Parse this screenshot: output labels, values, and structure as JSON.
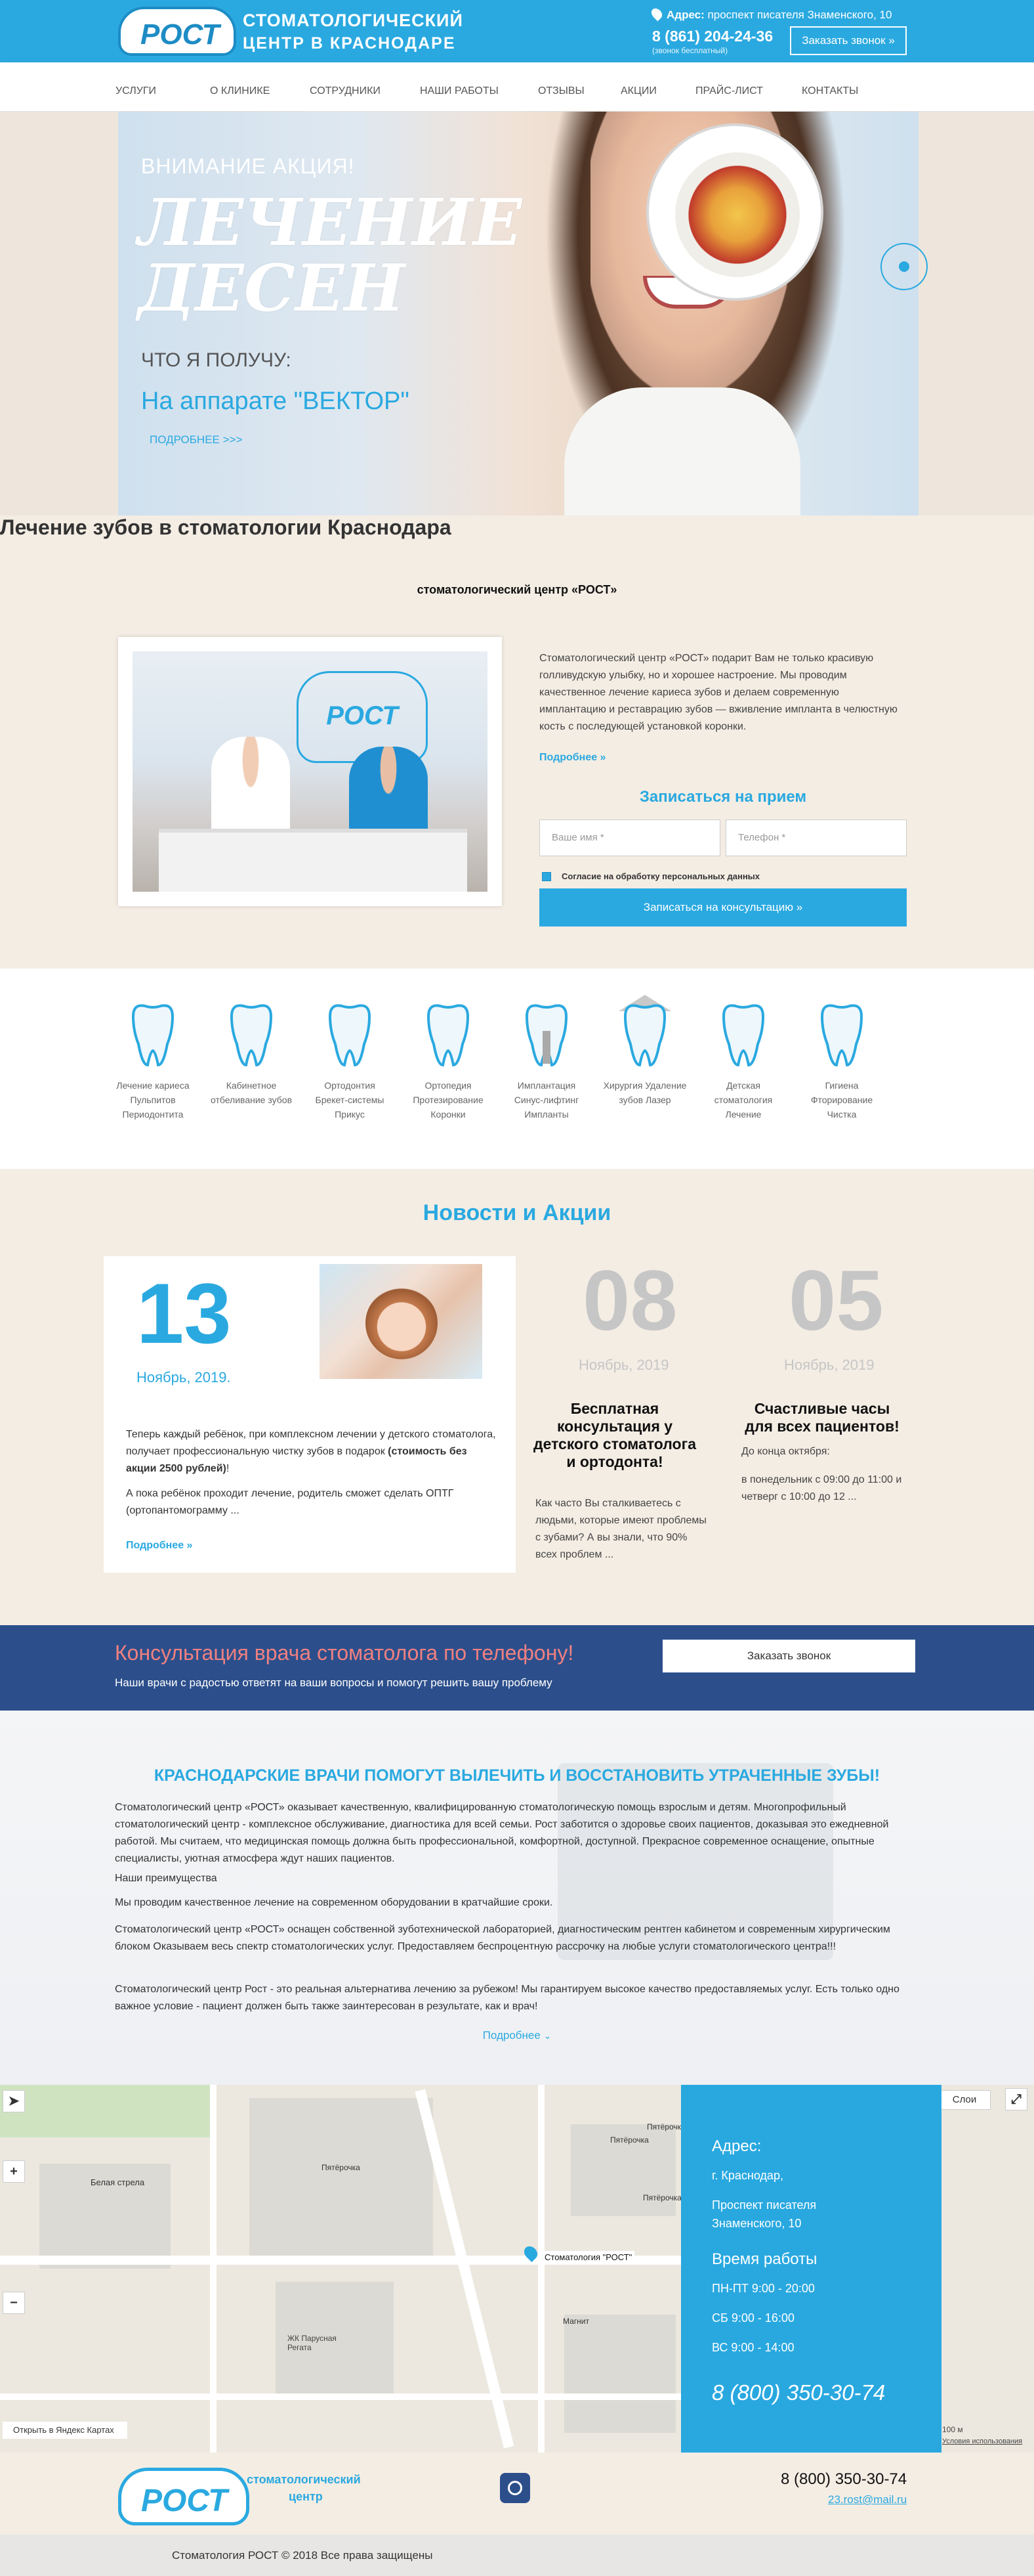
{
  "header": {
    "logo_word": "РОСТ",
    "logo_line1": "СТОМАТОЛОГИЧЕСКИЙ",
    "logo_line2": "ЦЕНТР В КРАСНОДАРЕ",
    "address_label": "Адрес:",
    "address": "проспект писателя Знаменского, 10",
    "phone": "8 (861) 204-24-36",
    "phone_note": "(звонок бесплатный)",
    "callback": "Заказать звонок"
  },
  "nav": [
    "Услуги",
    "О клинике",
    "Сотрудники",
    "Наши работы",
    "Отзывы",
    "Акции",
    "Прайс-лист",
    "Контакты"
  ],
  "hero": {
    "kicker": "ВНИМАНИЕ АКЦИЯ!",
    "title_l1": "ЛЕЧЕНИЕ",
    "title_l2": "ДЕСЕН",
    "question": "ЧТО Я ПОЛУЧУ:",
    "device": "На аппарате \"ВЕКТОР\"",
    "more": "ПОДРОБНЕЕ >>>"
  },
  "about": {
    "title": "Лечение зубов в стоматологии Краснодара",
    "subtitle": "стоматологический центр «РОСТ»",
    "wall_logo": "РОСТ",
    "text": "Стоматологический центр «РОСТ» подарит Вам не только красивую голливудскую улыбку, но и хорошее настроение. Мы проводим качественное лечение кариеса зубов и делаем современную имплантацию и реставрацию зубов — вживление импланта в челюстную кость с последующей установкой коронки.",
    "more": "Подробнее »",
    "form_title": "Записаться на прием",
    "name_placeholder": "Ваше имя *",
    "phone_placeholder": "Телефон *",
    "consent": "Согласие на обработку персональных данных",
    "submit": "Записаться на консультацию »"
  },
  "services": [
    {
      "l1": "Лечение кариеса",
      "l2": "Пульпитов",
      "l3": "Периодонтита"
    },
    {
      "l1": "Кабинетное",
      "l2": "отбеливание зубов",
      "l3": ""
    },
    {
      "l1": "Ортодонтия",
      "l2": "Брекет-системы",
      "l3": "Прикус"
    },
    {
      "l1": "Ортопедия",
      "l2": "Протезирование",
      "l3": "Коронки"
    },
    {
      "l1": "Имплантация",
      "l2": "Синус-лифтинг",
      "l3": "Импланты"
    },
    {
      "l1": "Хирургия Удаление",
      "l2": "зубов Лазер",
      "l3": ""
    },
    {
      "l1": "Детская",
      "l2": "стоматология",
      "l3": "Лечение"
    },
    {
      "l1": "Гигиена",
      "l2": "Фторирование",
      "l3": "Чистка"
    }
  ],
  "news": {
    "title": "Новости и Акции",
    "main": {
      "day": "13",
      "month": "Ноябрь, 2019.",
      "p1_a": "Теперь каждый ребёнок, при комплексном лечении у детского стоматолога, получает профессиональную чистку зубов в подарок ",
      "p1_b": "(стоимость без акции 2500 рублей)",
      "p1_c": "!",
      "p2": "А пока ребёнок проходит лечение, родитель сможет сделать ОПТГ (ортопантомограмму ...",
      "more": "Подробнее »"
    },
    "items": [
      {
        "day": "08",
        "month": "Ноябрь, 2019",
        "title": "Бесплатная консультация у детского стоматолога и ортодонта!",
        "text": "Как часто  Вы сталкиваетесь с людьми, которые имеют проблемы с зубами? А вы знали, что 90% всех проблем ..."
      },
      {
        "day": "05",
        "month": "Ноябрь, 2019",
        "title": "Счастливые часы для всех пациентов!",
        "text1": "До конца октября:",
        "text2": "в понедельник с 09:00 до 11:00 и четверг с 10:00 до 12 ..."
      }
    ]
  },
  "band": {
    "title": "Консультация врача стоматолога по телефону!",
    "subtitle": "Наши врачи с радостью ответят на ваши вопросы и помогут решить вашу проблему",
    "button": "Заказать звонок"
  },
  "info": {
    "title": "КРАСНОДАРСКИЕ ВРАЧИ ПОМОГУТ ВЫЛЕЧИТЬ И ВОССТАНОВИТЬ УТРАЧЕННЫЕ ЗУБЫ!",
    "p1": "Стоматологический центр «РОСТ» оказывает качественную, квалифицированную стоматологическую помощь взрослым и детям. Многопрофильный стоматологический центр - комплексное обслуживание, диагностика для всей семьи. Рост заботится о здоровье своих пациентов, доказывая это ежедневной работой. Мы считаем, что медицинская помощь должна быть профессиональной, комфортной, доступной. Прекрасное современное оснащение, опытные специалисты, уютная атмосфера ждут наших пациентов.",
    "p2": "Наши преимущества",
    "p3": "Мы проводим качественное лечение на современном оборудовании в кратчайшие сроки.",
    "p4": "Стоматологический центр «РОСТ» оснащен собственной зуботехнической лабораторией, диагностическим рентген кабинетом и современным хирургическим блоком Оказываем весь спектр стоматологических услуг. Предоставляем беспроцентную рассрочку на любые услуги стоматологического центра!!!",
    "p5": "Стоматологический центр Рост - это реальная альтернатива лечению за рубежом! Мы гарантируем высокое качество предоставляемых услуг. Есть только одно важное условие - пациент должен быть также заинтересован в результате, как и врач!",
    "more": "Подробнее"
  },
  "map": {
    "labels": [
      "Белая стрела",
      "Пятёрочка",
      "Пятёрочка",
      "Пятёрочка",
      "Магнит",
      "Стоматология \"РОСТ\"",
      "ЖК Парусная Регата",
      "Пятёрочка"
    ],
    "layers": "Слои",
    "open": "Открыть в Яндекс Картах",
    "scale": "100 м",
    "terms": "Условия использования"
  },
  "contact": {
    "addr_title": "Адрес:",
    "addr1": "г. Краснодар,",
    "addr2": "Проспект писателя",
    "addr3": "Знаменского, 10",
    "hours_title": "Время работы",
    "h1": "ПН-ПТ 9:00 - 20:00",
    "h2": "СБ 9:00 - 16:00",
    "h3": "ВС 9:00 - 14:00",
    "phone": "8 (800) 350-30-74"
  },
  "footer": {
    "logo_word": "РОСТ",
    "logo_l1": "стоматологический",
    "logo_l2": "центр",
    "phone": "8 (800) 350-30-74",
    "email": "23.rost@mail.ru",
    "copyright": "Стоматология РОСТ © 2018 Все права защищены"
  },
  "colors": {
    "accent": "#2aa9e0",
    "band": "#2c4f8c",
    "beige": "#f4ede4",
    "promo": "#f08080"
  }
}
